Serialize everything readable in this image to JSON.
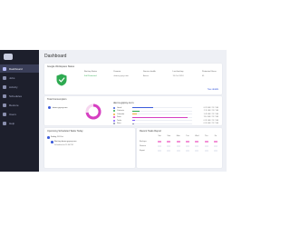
{
  "sidebar": {
    "items": [
      {
        "label": "Dashboard",
        "icon": "dashboard-icon",
        "active": true
      },
      {
        "label": "Jobs",
        "icon": "jobs-icon",
        "active": false
      },
      {
        "label": "Activity",
        "icon": "activity-icon",
        "active": false
      },
      {
        "label": "Schedules",
        "icon": "schedules-icon",
        "active": false
      },
      {
        "label": "Restore",
        "icon": "restore-icon",
        "active": false
      },
      {
        "label": "Users",
        "icon": "users-icon",
        "active": false
      },
      {
        "label": "Help",
        "icon": "help-icon",
        "active": false
      }
    ]
  },
  "page": {
    "title": "Dashboard"
  },
  "status": {
    "title": "Google Workspace Status",
    "columns": [
      {
        "label": "Backup Status",
        "value": "Full Protected",
        "green": true
      },
      {
        "label": "Domain",
        "value": "demo.gcpsy.com",
        "green": false
      },
      {
        "label": "Service health",
        "value": "Active",
        "green": false
      },
      {
        "label": "Last backup",
        "value": "15 Oct 2024",
        "green": false
      },
      {
        "label": "Protected Users",
        "value": "61",
        "green": false
      }
    ],
    "link": "See details"
  },
  "storage": {
    "title": "Total Consumption",
    "chip": "demo.gcpsy.com",
    "domain": "demo.gcpsy.com",
    "donut_percent": 72,
    "accent": "#d63fc2",
    "legend": [
      {
        "name": "Gmail",
        "color": "#3b5bdb",
        "fill": 0.35,
        "value": "6.23 GB / 23.7 GB"
      },
      {
        "name": "Contacts",
        "color": "#2eaa51",
        "fill": 0.12,
        "value": "2.11 GB / 23.7 GB"
      },
      {
        "name": "Calendar",
        "color": "#f2a93b",
        "fill": 0.08,
        "value": "1.45 GB / 23.7 GB"
      },
      {
        "name": "Drive",
        "color": "#d63fc2",
        "fill": 0.92,
        "value": "13.4 GB / 23.7 GB"
      },
      {
        "name": "Tasks",
        "color": "#7c5cff",
        "fill": 0.05,
        "value": "0.31 GB / 23.7 GB"
      },
      {
        "name": "Sites",
        "color": "#8a8fae",
        "fill": 0.03,
        "value": "0.20 GB / 23.7 GB"
      }
    ]
  },
  "upcoming": {
    "title": "Upcoming Scheduled Tasks Today",
    "date": "Friday, 18 Oct",
    "item": "Backup demo.gcpsy.com",
    "sub": "Scheduled at 11:00 PM"
  },
  "recent": {
    "title": "Recent Tasks Report",
    "days": [
      "Sat",
      "Sun",
      "Mon",
      "Tue",
      "Wed",
      "Thu",
      "Fri"
    ],
    "rows": [
      {
        "label": "Backups",
        "colors": [
          "#f28fd6",
          "#f28fd6",
          "#f28fd6",
          "#f28fd6",
          "#f28fd6",
          "#f28fd6",
          "#f28fd6"
        ]
      },
      {
        "label": "Restore",
        "colors": [
          "#eceef4",
          "#eceef4",
          "#eceef4",
          "#eceef4",
          "#eceef4",
          "#eceef4",
          "#eceef4"
        ]
      },
      {
        "label": "Export",
        "colors": [
          "#eceef4",
          "#eceef4",
          "#eceef4",
          "#eceef4",
          "#eceef4",
          "#eceef4",
          "#eceef4"
        ]
      }
    ]
  }
}
